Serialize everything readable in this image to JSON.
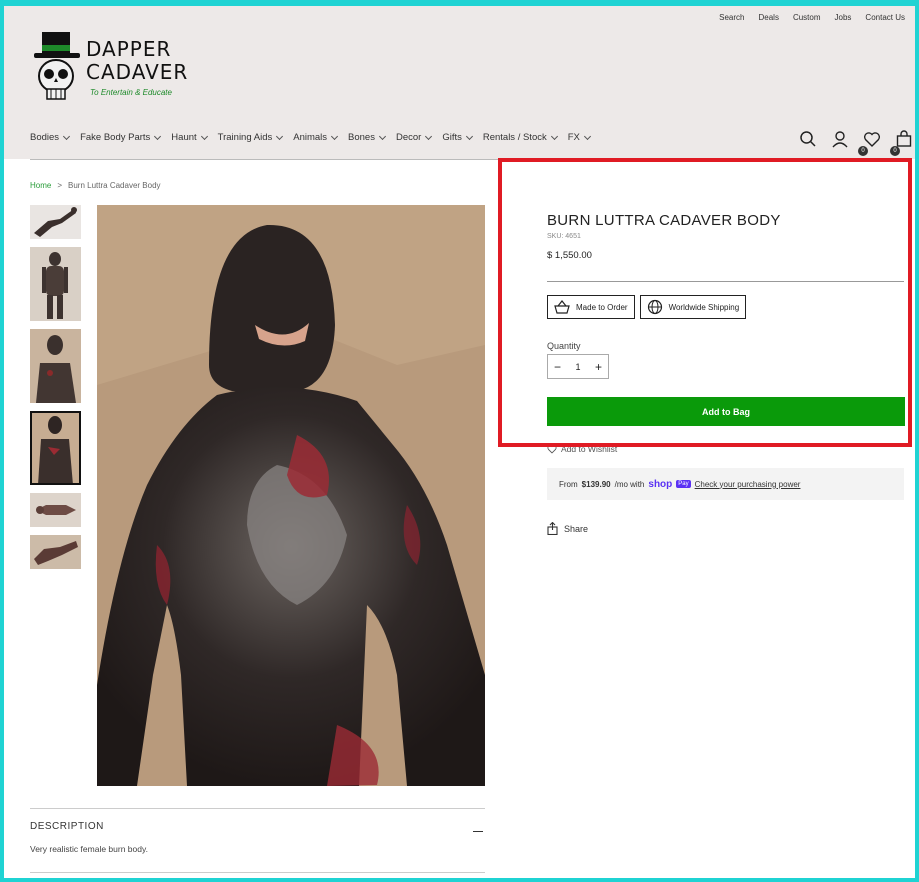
{
  "utility_links": [
    "Search",
    "Deals",
    "Custom",
    "Jobs",
    "Contact Us"
  ],
  "brand": {
    "line1": "DAPPER",
    "line2": "CADAVER",
    "tagline": "To Entertain & Educate",
    "accent": "#1e8a2a"
  },
  "nav": [
    "Bodies",
    "Fake Body Parts",
    "Haunt",
    "Training Aids",
    "Animals",
    "Bones",
    "Decor",
    "Gifts",
    "Rentals / Stock",
    "FX"
  ],
  "header_icons": {
    "search": "search-icon",
    "account": "user-icon",
    "wishlist": "heart-icon",
    "wishlist_count": "0",
    "bag": "bag-icon",
    "bag_count": "0"
  },
  "breadcrumb": {
    "home": "Home",
    "separator": ">",
    "current": "Burn Luttra Cadaver Body"
  },
  "product": {
    "title": "BURN LUTTRA CADAVER BODY",
    "sku": "SKU: 4651",
    "price": "$ 1,550.00",
    "badges": [
      "Made to Order",
      "Worldwide Shipping"
    ],
    "quantity_label": "Quantity",
    "quantity": "1",
    "minus": "−",
    "plus": "+",
    "add_to_bag": "Add to Bag",
    "wishlist": "Add to Wishlist",
    "shoppay": {
      "prefix": "From",
      "amount": "$139.90",
      "suffix": "/mo with",
      "brand": "shop",
      "pay": "Pay",
      "link": "Check your purchasing power"
    },
    "share": "Share",
    "button_color": "#0a9a0a"
  },
  "description": {
    "heading": "DESCRIPTION",
    "text": "Very realistic female burn body."
  },
  "highlight_color": "#e01b24"
}
